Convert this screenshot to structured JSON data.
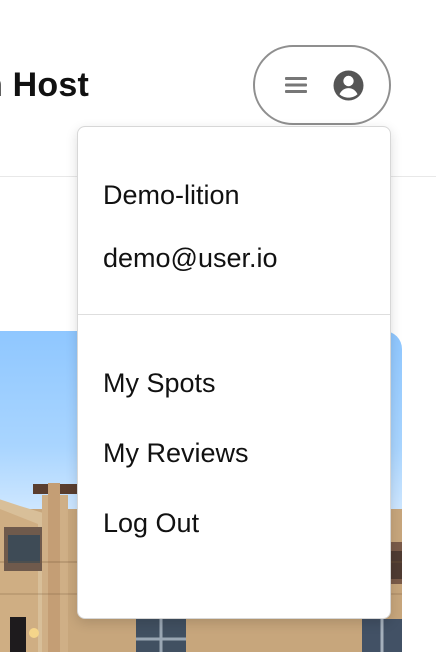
{
  "header": {
    "title_fragment": "n Host"
  },
  "profile_button": {
    "menu_icon": "hamburger-icon",
    "user_icon": "user-circle-icon"
  },
  "dropdown": {
    "user_name": "Demo-lition",
    "user_email": "demo@user.io",
    "items": [
      {
        "label": "My Spots"
      },
      {
        "label": "My Reviews"
      },
      {
        "label": "Log Out"
      }
    ]
  }
}
